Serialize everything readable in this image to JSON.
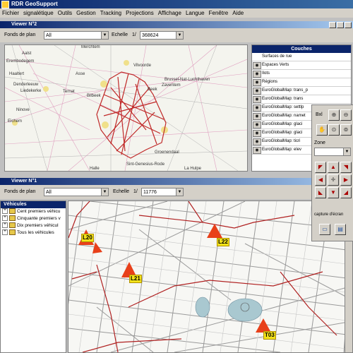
{
  "app": {
    "title": "RDR GeoSupport"
  },
  "menu": [
    "Fichier",
    "signalétique",
    "Outils",
    "Gestion",
    "Tracking",
    "Projections",
    "Affichage",
    "Langue",
    "Fenêtre",
    "Aide"
  ],
  "viewer2": {
    "title": "Viewer N°2",
    "fonds_label": "Fonds de plan",
    "fonds_value": "All",
    "echelle_label": "Echelle",
    "echelle_prefix": "1/",
    "echelle_value": "368624",
    "places": [
      "Merchtem",
      "Aalst",
      "Erembodegem",
      "Haaltert",
      "Asse",
      "Vilvoorde",
      "Brussel-Nat-Luchthaven",
      "Zaventem",
      "Denderleeuw",
      "Liedekerke",
      "Ternat",
      "Bilbeek",
      "Ninove",
      "Eichem",
      "Groenendaal",
      "Sint-Genesius-Rode",
      "Halle",
      "La Hulpe",
      "Beek"
    ]
  },
  "couches": {
    "title": "Couches",
    "layers": [
      "Surfaces de rue",
      "Espaces Verts",
      "Ilots",
      "Régions",
      "EuroGlobalMap: trans_p",
      "EuroGlobalMap: trans",
      "EuroGlobalMap: settlp",
      "EuroGlobalMap: namet",
      "EuroGlobalMap: glaci",
      "EuroGlobalMap: glaci",
      "EuroGlobalMap: ticri",
      "EuroGlobalMap: elev"
    ]
  },
  "tools": {
    "bxl_label": "Bxl",
    "zone_label": "Zone",
    "capture_label": "capture d'écran"
  },
  "viewer1": {
    "title": "Viewer N°1",
    "fonds_label": "Fonds de plan",
    "fonds_value": "All",
    "echelle_label": "Echelle",
    "echelle_prefix": "1/",
    "echelle_value": "11776"
  },
  "vehicules": {
    "title": "Véhicules",
    "items": [
      "Cent premiers véhicu",
      "Cinquante premiers v",
      "Dix premiers véhicul",
      "Tous les véhicules"
    ]
  },
  "markers": [
    "L20",
    "L22",
    "L21",
    "T03"
  ],
  "colors": {
    "title_bar": "#0a246a",
    "chrome": "#d4d0c8",
    "route": "#b02020",
    "marker": "#e8401a",
    "label": "#f2e21a"
  }
}
